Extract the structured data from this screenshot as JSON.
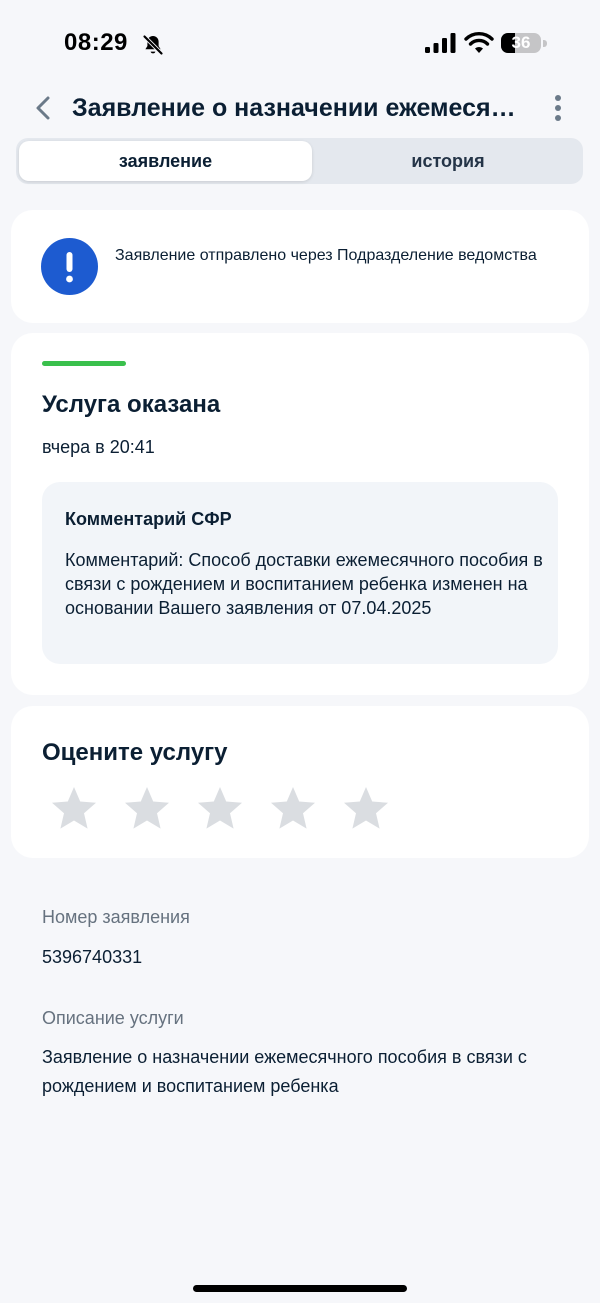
{
  "status_bar": {
    "time": "08:29",
    "battery_level": "36",
    "battery_fraction": 0.36
  },
  "header": {
    "title": "Заявление о назначении ежемесячного пособия в связи с рождением и воспитанием ребенка",
    "back_icon": "chevron-left-icon",
    "menu_icon": "kebab-menu-icon"
  },
  "tabs": [
    {
      "label": "заявление",
      "active": true
    },
    {
      "label": "история",
      "active": false
    }
  ],
  "notice": {
    "icon": "exclamation-icon",
    "text": "Заявление отправлено через Подразделение ведомства",
    "icon_color": "#1d5bd0"
  },
  "status": {
    "progress_fraction": 1.0,
    "progress_color": "#3ac04c",
    "title": "Услуга оказана",
    "time": "вчера в 20:41",
    "comment": {
      "title": "Комментарий СФР",
      "body": "Комментарий: Способ доставки ежемесячного пособия в связи с рождением и воспитанием ребенка изменен на основании Вашего заявления от 07.04.2025"
    }
  },
  "rating": {
    "title": "Оцените услугу",
    "value": 0,
    "max": 5,
    "star_color": "#dadde1"
  },
  "details": {
    "number_label": "Номер заявления",
    "number_value": "5396740331",
    "description_label": "Описание услуги",
    "description_value": "Заявление о назначении ежемесячного пособия в связи с рождением и воспитанием ребенка"
  }
}
